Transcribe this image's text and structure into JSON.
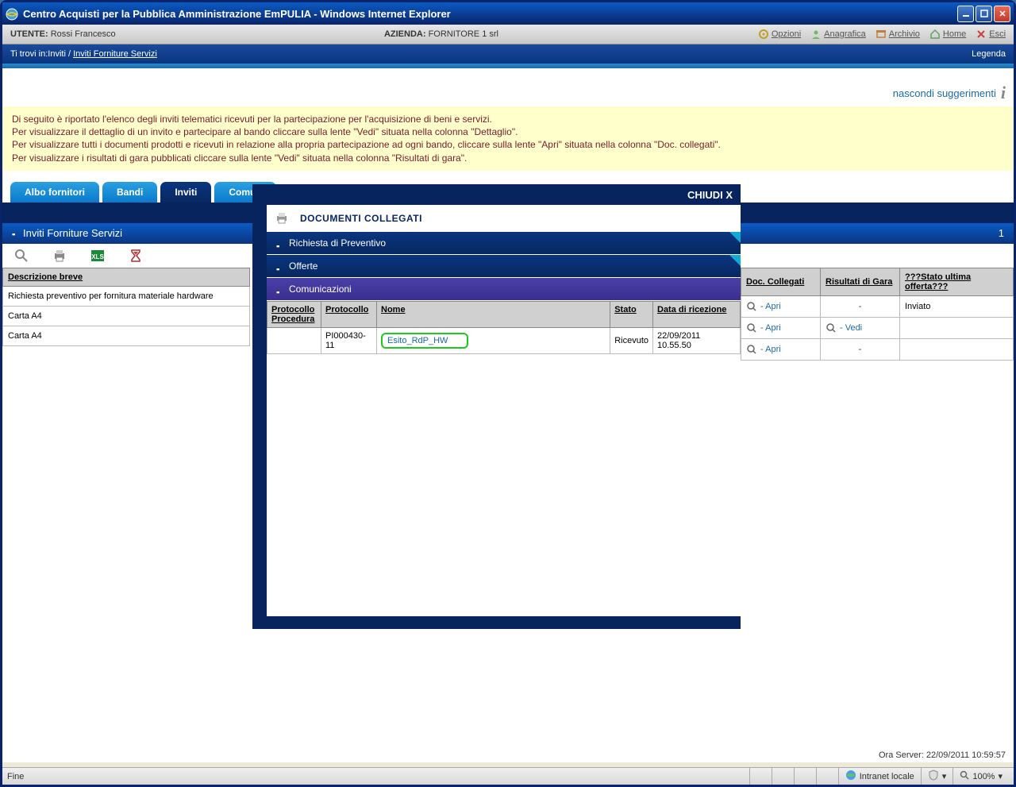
{
  "window": {
    "title": "Centro Acquisti per la Pubblica Amministrazione EmPULIA - Windows Internet Explorer"
  },
  "topbar": {
    "user_label": "UTENTE:",
    "user_name": "Rossi Francesco",
    "company_label": "AZIENDA:",
    "company_name": "FORNITORE 1 srl",
    "links": {
      "opzioni": "Opzioni",
      "anagrafica": "Anagrafica",
      "archivio": "Archivio",
      "home": "Home",
      "esci": "Esci"
    }
  },
  "breadcrumb": {
    "prefix": "Ti trovi in:",
    "path1": "Inviti",
    "path2": "Inviti Forniture Servizi",
    "legenda": "Legenda"
  },
  "hints": {
    "toggle": "nascondi suggerimenti",
    "line1": "Di seguito è riportato l'elenco degli inviti telematici ricevuti per la partecipazione per l'acquisizione di beni e servizi.",
    "line2": "Per visualizzare il dettaglio di un invito e partecipare al bando cliccare sulla lente \"Vedi\" situata nella colonna \"Dettaglio\".",
    "line3": "Per visualizzare tutti i documenti prodotti e ricevuti in relazione alla propria partecipazione ad ogni bando, cliccare sulla lente \"Apri\" situata nella colonna \"Doc. collegati\".",
    "line4": "Per visualizzare i risultati di gara pubblicati cliccare sulla lente \"Vedi\" situata nella colonna \"Risultati di gara\"."
  },
  "tabs": {
    "albo": "Albo fornitori",
    "bandi": "Bandi",
    "inviti": "Inviti",
    "comunicazioni": "Comun"
  },
  "section": {
    "title": "Inviti Forniture Servizi",
    "count": "1"
  },
  "leftTable": {
    "header": "Descrizione breve",
    "rows": [
      "Richiesta preventivo per fornitura materiale hardware",
      "Carta A4",
      "Carta A4"
    ]
  },
  "rightTable": {
    "headers": {
      "doc": "Doc. Collegati",
      "risultati": "Risultati di Gara",
      "stato": "???Stato ultima offerta???"
    },
    "apri": "- Apri",
    "vedi": "- Vedi",
    "dash": "-",
    "inviato": "Inviato"
  },
  "modal": {
    "close": "CHIUDI X",
    "title": "DOCUMENTI COLLEGATI",
    "acc": {
      "rdp": "Richiesta di Preventivo",
      "offerte": "Offerte",
      "comunicazioni": "Comunicazioni"
    },
    "table": {
      "headers": {
        "protproc": "Protocollo Procedura",
        "protocollo": "Protocollo",
        "nome": "Nome",
        "stato": "Stato",
        "datar": "Data di ricezione"
      },
      "row": {
        "protproc": "",
        "protocollo": "PI000430-11",
        "nome": "Esito_RdP_HW",
        "stato": "Ricevuto",
        "datar": "22/09/2011 10.55.50"
      }
    }
  },
  "server": {
    "time": "Ora Server: 22/09/2011 10:59:57"
  },
  "statusbar": {
    "left": "Fine",
    "zone": "Intranet locale",
    "zoom": "100%"
  }
}
